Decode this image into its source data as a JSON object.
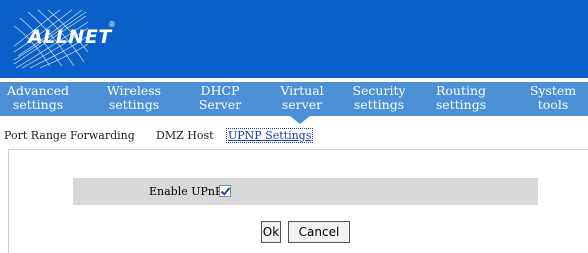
{
  "brand": {
    "logo_text": "ALLNET",
    "logo_mark": "®"
  },
  "nav": [
    {
      "line1": "Advanced",
      "line2": "settings"
    },
    {
      "line1": "Wireless",
      "line2": "settings"
    },
    {
      "line1": "DHCP",
      "line2": "Server"
    },
    {
      "line1": "Virtual",
      "line2": "server"
    },
    {
      "line1": "Security",
      "line2": "settings"
    },
    {
      "line1": "Routing",
      "line2": "settings"
    },
    {
      "line1": "System",
      "line2": "tools"
    }
  ],
  "subtabs": {
    "port_range": "Port Range Forwarding",
    "dmz": "DMZ Host",
    "upnp": "UPNP Settings"
  },
  "form": {
    "enable_upnp_label": "Enable UPnP",
    "enable_upnp_checked": true
  },
  "buttons": {
    "ok": "Ok",
    "cancel": "Cancel"
  },
  "colors": {
    "header": "#0a60c8",
    "nav": "#4c90d8",
    "row": "#d8d8d8"
  }
}
